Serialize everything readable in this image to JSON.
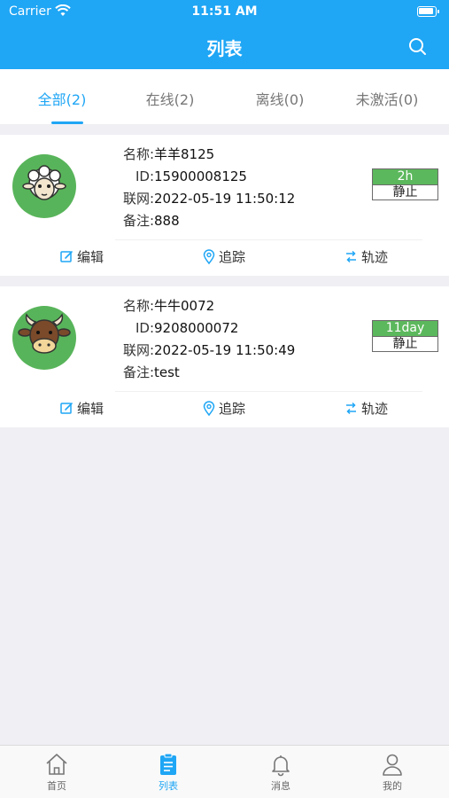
{
  "status_bar": {
    "carrier": "Carrier",
    "time": "11:51 AM"
  },
  "nav": {
    "title": "列表",
    "search_icon": "search-icon"
  },
  "tabs": [
    {
      "label": "全部(2)",
      "active": true
    },
    {
      "label": "在线(2)",
      "active": false
    },
    {
      "label": "离线(0)",
      "active": false
    },
    {
      "label": "未激活(0)",
      "active": false
    }
  ],
  "devices": [
    {
      "avatar": "sheep-icon",
      "name_label": "名称:",
      "name": "羊羊8125",
      "id_label": "ID:",
      "id": "15900008125",
      "net_label": "联网:",
      "net": "2022-05-19 11:50:12",
      "note_label": "备注:",
      "note": "888",
      "duration": "2h",
      "state": "静止",
      "actions": {
        "edit": "编辑",
        "track": "追踪",
        "trail": "轨迹"
      }
    },
    {
      "avatar": "cow-icon",
      "name_label": "名称:",
      "name": "牛牛0072",
      "id_label": "ID:",
      "id": "9208000072",
      "net_label": "联网:",
      "net": "2022-05-19 11:50:49",
      "note_label": "备注:",
      "note": "test",
      "duration": "11day",
      "state": "静止",
      "actions": {
        "edit": "编辑",
        "track": "追踪",
        "trail": "轨迹"
      }
    }
  ],
  "tabbar": [
    {
      "label": "首页",
      "icon": "home-icon",
      "active": false
    },
    {
      "label": "列表",
      "icon": "list-icon",
      "active": true
    },
    {
      "label": "消息",
      "icon": "bell-icon",
      "active": false
    },
    {
      "label": "我的",
      "icon": "user-icon",
      "active": false
    }
  ],
  "colors": {
    "primary": "#1fa6f5",
    "badge_green": "#5cb85c",
    "avatar_green": "#58b45a"
  }
}
